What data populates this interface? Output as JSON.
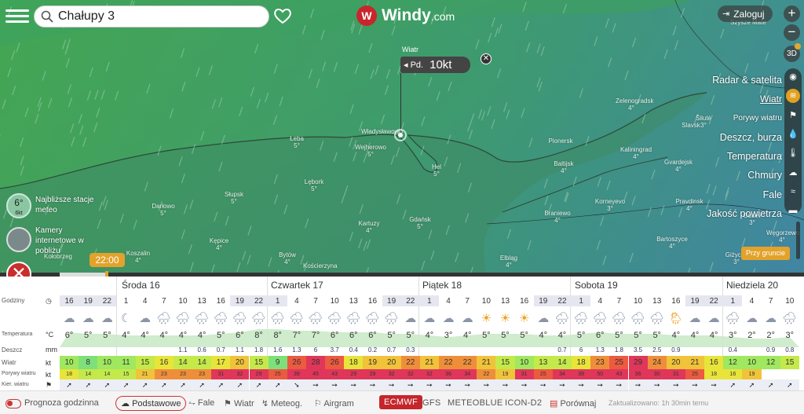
{
  "header": {
    "search_value": "Chałupy 3",
    "logo_text": "Windy",
    "logo_suffix": ".com",
    "login_label": "Zaloguj",
    "zoom_in": "+",
    "zoom_out": "−",
    "btn_3d": "3D"
  },
  "map": {
    "wind_popup": {
      "label": "Wiatr",
      "direction": "Pd.",
      "speed": "10kt"
    },
    "cities": [
      {
        "name": "Łeba",
        "t": "5°"
      },
      {
        "name": "Władysławowo",
        "t": ""
      },
      {
        "name": "Wejherowo",
        "t": "5°"
      },
      {
        "name": "Hel",
        "t": "5°"
      },
      {
        "name": "Lębork",
        "t": "5°"
      },
      {
        "name": "Słupsk",
        "t": "5°"
      },
      {
        "name": "Darłowo",
        "t": "5°"
      },
      {
        "name": "Kępice",
        "t": "4°"
      },
      {
        "name": "Koszalin",
        "t": "4°"
      },
      {
        "name": "Kołobrzeg",
        "t": ""
      },
      {
        "name": "Bytów",
        "t": "4°"
      },
      {
        "name": "Kartuzy",
        "t": "4°"
      },
      {
        "name": "Gdańsk",
        "t": "5°"
      },
      {
        "name": "Kościerzyna",
        "t": ""
      },
      {
        "name": "Elbląg",
        "t": "4°"
      },
      {
        "name": "Kaliningrad",
        "t": "4°"
      },
      {
        "name": "Baltijsk",
        "t": "4°"
      },
      {
        "name": "Zelenogradsk",
        "t": "4°"
      },
      {
        "name": "Gvardejsk",
        "t": "4°"
      },
      {
        "name": "Pionersk",
        "t": ""
      },
      {
        "name": "Braniewo",
        "t": "4°"
      },
      {
        "name": "Korneyevo",
        "t": "3°"
      },
      {
        "name": "Pravdinsk",
        "t": "4°"
      },
      {
        "name": "Bartoszyce",
        "t": "4°"
      },
      {
        "name": "Giżycko",
        "t": "3°"
      },
      {
        "name": "Węgorzewo",
        "t": "4°"
      },
      {
        "name": "Gusev",
        "t": "3°"
      },
      {
        "name": "Slavsk",
        "t": ""
      },
      {
        "name": "Šilutė",
        "t": "3°"
      },
      {
        "name": "Szysze Mate",
        "t": ""
      }
    ],
    "near_stations": {
      "temp": "6°",
      "wind": "6kt",
      "label": "Najbliższe stacje meteo"
    },
    "webcams_label": "Kamery internetowe w pobliżu",
    "time_label": "22:00",
    "premium_button": "Przy gruncie",
    "layers": [
      {
        "label": "Radar & satelita",
        "icon": "radar-icon"
      },
      {
        "label": "Wiatr",
        "icon": "wind-icon",
        "active": true
      },
      {
        "label": "Porywy wiatru",
        "icon": "flag-icon",
        "small": true
      },
      {
        "label": "Deszcz, burza",
        "icon": "rain-icon"
      },
      {
        "label": "Temperatura",
        "icon": "thermometer-icon"
      },
      {
        "label": "Chmury",
        "icon": "cloud-icon"
      },
      {
        "label": "Fale",
        "icon": "waves-icon"
      },
      {
        "label": "Jakość powietrza",
        "icon": "car-icon"
      }
    ]
  },
  "forecast": {
    "labels": {
      "hours": "Godziny",
      "temp": "Temperatura",
      "rain": "Deszcz",
      "wind": "Wiatr",
      "gust": "Porywy wiatru",
      "dir": "Kier. wiatru"
    },
    "units": {
      "temp": "°C",
      "rain": "mm",
      "wind": "kt",
      "gust": "kt"
    },
    "days": [
      {
        "name": "Środa 16"
      },
      {
        "name": "Czwartek 17"
      },
      {
        "name": "Piątek 18"
      },
      {
        "name": "Sobota 19"
      },
      {
        "name": "Niedziela 20"
      }
    ],
    "hours": [
      "16",
      "19",
      "22",
      "1",
      "4",
      "7",
      "10",
      "13",
      "16",
      "19",
      "22",
      "1",
      "4",
      "7",
      "10",
      "13",
      "16",
      "19",
      "22",
      "1",
      "4",
      "7",
      "10",
      "13",
      "16",
      "19",
      "22",
      "1",
      "4",
      "7",
      "10",
      "13",
      "16",
      "19",
      "22",
      "1",
      "4",
      "7",
      "10"
    ],
    "weather": [
      "cloud",
      "cloud",
      "cloud",
      "moon",
      "cloud",
      "rain",
      "rain",
      "rain",
      "rain",
      "rain",
      "rain",
      "rain",
      "rain",
      "rain",
      "rain",
      "rain",
      "rain",
      "rain",
      "cloud",
      "cloud",
      "cloud",
      "cloud",
      "sun",
      "sun",
      "sun",
      "cloud",
      "rain",
      "rain",
      "rain",
      "rain",
      "rain",
      "rain",
      "sunrain",
      "cloud",
      "cloud",
      "rain",
      "cloud",
      "cloud",
      "rain"
    ],
    "temps": [
      "6°",
      "5°",
      "5°",
      "4°",
      "4°",
      "4°",
      "4°",
      "4°",
      "5°",
      "6°",
      "8°",
      "8°",
      "7°",
      "7°",
      "6°",
      "6°",
      "6°",
      "5°",
      "5°",
      "4°",
      "3°",
      "4°",
      "5°",
      "5°",
      "5°",
      "4°",
      "4°",
      "5°",
      "6°",
      "5°",
      "5°",
      "5°",
      "4°",
      "4°",
      "4°",
      "3°",
      "2°",
      "2°",
      "3°"
    ],
    "rain": [
      "",
      "",
      "",
      "",
      "",
      "",
      "1.1",
      "0.6",
      "0.7",
      "1.1",
      "1.8",
      "1.6",
      "1.3",
      "6",
      "3.7",
      "0.4",
      "0.2",
      "0.7",
      "0.3",
      "",
      "",
      "",
      "",
      "",
      "",
      "",
      "0.7",
      "6",
      "1.3",
      "1.8",
      "3.5",
      "2.5",
      "0.9",
      "",
      "",
      "0.4",
      "",
      "0.9",
      "0.8"
    ],
    "wind": [
      10,
      8,
      10,
      11,
      15,
      16,
      14,
      14,
      17,
      20,
      15,
      9,
      26,
      28,
      26,
      18,
      19,
      20,
      22,
      21,
      22,
      22,
      21,
      15,
      10,
      13,
      14,
      18,
      23,
      25,
      29,
      24,
      20,
      21,
      16,
      12,
      10,
      12,
      15
    ],
    "gust": [
      18,
      14,
      14,
      15,
      21,
      23,
      23,
      23,
      31,
      32,
      29,
      25,
      39,
      45,
      43,
      29,
      29,
      32,
      32,
      32,
      36,
      34,
      22,
      19,
      31,
      25,
      34,
      39,
      50,
      43,
      36,
      30,
      31,
      25,
      18,
      16,
      19
    ],
    "dir": [
      "➚",
      "➚",
      "➚",
      "➚",
      "➚",
      "➚",
      "➚",
      "➚",
      "➚",
      "➚",
      "➚",
      "➚",
      "➘",
      "➙",
      "➙",
      "➙",
      "➙",
      "➙",
      "➙",
      "➙",
      "➙",
      "➙",
      "➙",
      "➙",
      "➙",
      "➙",
      "➙",
      "➙",
      "➙",
      "➙",
      "➙",
      "➙",
      "➙",
      "➙",
      "➙",
      "➚",
      "➚",
      "➚",
      "➚"
    ]
  },
  "bottom_bar": {
    "toggle_label": "Prognoza godzinna",
    "tabs": [
      "Podstawowe",
      "Fale",
      "Wiatr",
      "Meteog.",
      "Airgram"
    ],
    "models": [
      "ECMWF",
      "GFS",
      "METEOBLUE",
      "ICON-D2"
    ],
    "compare": "Porównaj",
    "updated": "Zaktualizowano: 1h 30min temu"
  },
  "colors": {
    "accent": "#e3a22a",
    "brand": "#c8262d",
    "map_land": "#3fa55a",
    "map_sea": "#3f8f93"
  }
}
